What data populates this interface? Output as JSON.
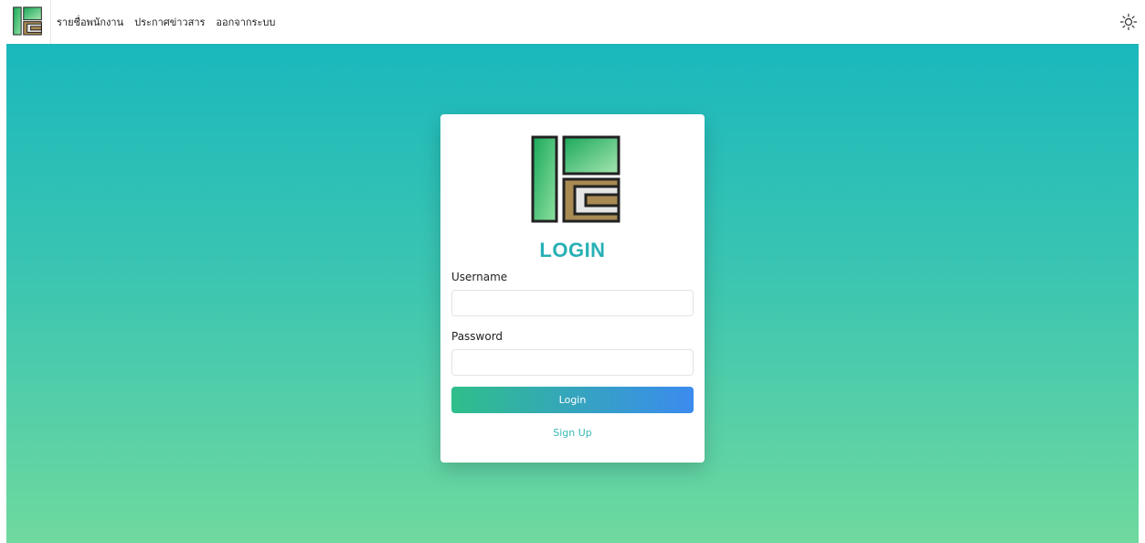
{
  "nav": {
    "links": [
      "รายชื่อพนักงาน",
      "ประกาศข่าวสาร",
      "ออกจากระบบ"
    ],
    "theme_icon": "sun-icon"
  },
  "login": {
    "title": "LOGIN",
    "username_label": "Username",
    "username_value": "",
    "password_label": "Password",
    "password_value": "",
    "button_label": "Login",
    "signup_label": "Sign Up"
  },
  "colors": {
    "accent": "#27b0b6",
    "gradient_top": "#1ab8bd",
    "gradient_bottom": "#6fd99e",
    "button_start": "#2fbf8a",
    "button_end": "#3b8bef"
  },
  "icons": {
    "brand_logo": "brand-logo-icon"
  }
}
